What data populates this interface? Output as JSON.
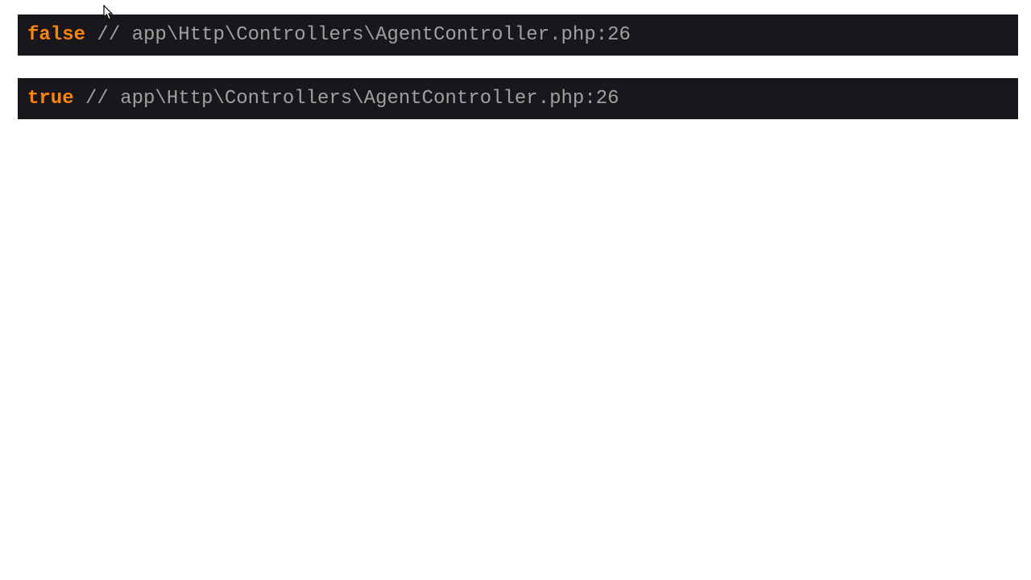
{
  "dumps": [
    {
      "value": "false",
      "commentPrefix": " // ",
      "path": "app\\Http\\Controllers\\AgentController.php:26"
    },
    {
      "value": "true",
      "commentPrefix": " // ",
      "path": "app\\Http\\Controllers\\AgentController.php:26"
    }
  ]
}
